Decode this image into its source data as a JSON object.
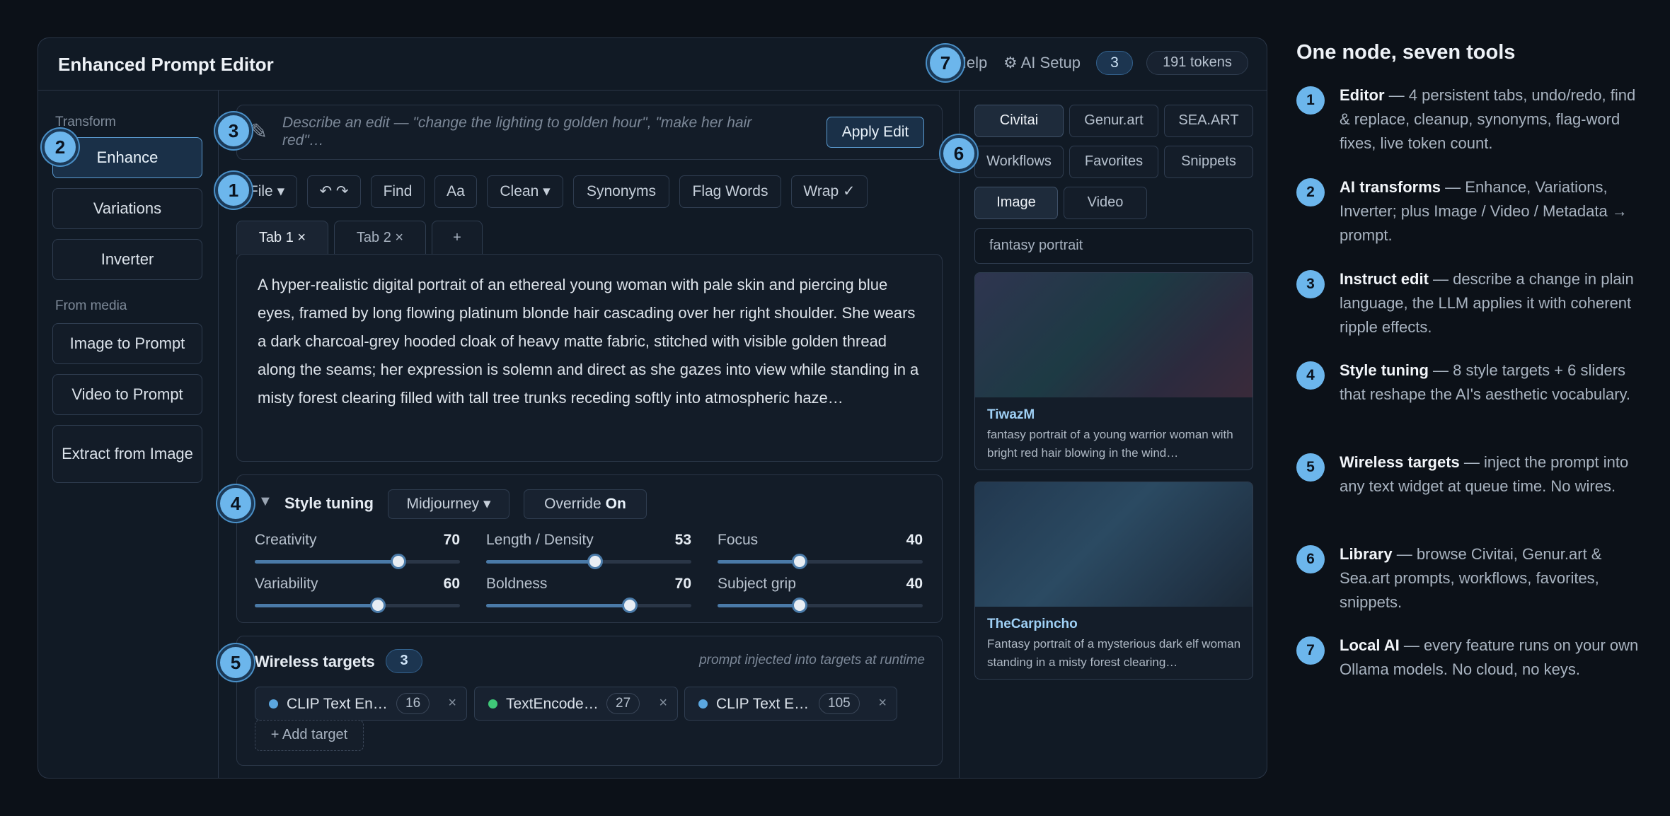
{
  "header": {
    "title": "Enhanced Prompt Editor",
    "help_label": "Help",
    "ai_setup_label": "⚙ AI Setup",
    "count": "3",
    "tokens": "191 tokens"
  },
  "sidebar": {
    "transform_label": "Transform",
    "transform_items": [
      "Enhance",
      "Variations",
      "Inverter"
    ],
    "media_label": "From media",
    "media_items": [
      "Image to Prompt",
      "Video to Prompt",
      "Extract from Image"
    ]
  },
  "instruct": {
    "placeholder": "Describe an edit — \"change the lighting to golden hour\", \"make her hair red\"…",
    "apply_label": "Apply Edit"
  },
  "toolbar": {
    "file": "File ▾",
    "undo_redo": "↶ ↷",
    "find": "Find",
    "aa": "Aa",
    "clean": "Clean ▾",
    "synonyms": "Synonyms",
    "flag_words": "Flag Words",
    "wrap": "Wrap ✓"
  },
  "tabs": [
    "Tab 1 ×",
    "Tab 2 ×",
    "+"
  ],
  "editor": {
    "text": "A hyper-realistic digital portrait of an ethereal young woman with pale skin and piercing blue eyes, framed by long flowing platinum blonde hair cascading over her right shoulder. She wears a dark charcoal-grey hooded cloak of heavy matte fabric, stitched with visible golden thread along the seams; her expression is solemn and direct as she gazes into view while standing in a misty forest clearing filled with tall tree trunks receding softly into atmospheric haze…"
  },
  "style_tuning": {
    "title": "Style tuning",
    "target": "Midjourney ▾",
    "override_label": "Override",
    "override_value": "On",
    "sliders": [
      {
        "label": "Creativity",
        "value": 70
      },
      {
        "label": "Length / Density",
        "value": 53
      },
      {
        "label": "Focus",
        "value": 40
      },
      {
        "label": "Variability",
        "value": 60
      },
      {
        "label": "Boldness",
        "value": 70
      },
      {
        "label": "Subject grip",
        "value": 40
      }
    ]
  },
  "wireless": {
    "title": "Wireless targets",
    "count": "3",
    "note": "prompt injected into targets at runtime",
    "targets": [
      {
        "name": "CLIP Text En…",
        "count": "16",
        "color": "#5ba7e0"
      },
      {
        "name": "TextEncode…",
        "count": "27",
        "color": "#3fc978"
      },
      {
        "name": "CLIP Text E…",
        "count": "105",
        "color": "#5ba7e0"
      }
    ],
    "add_label": "+ Add target"
  },
  "library": {
    "sources": [
      "Civitai",
      "Genur.art",
      "SEA.ART"
    ],
    "sections": [
      "Workflows",
      "Favorites",
      "Snippets"
    ],
    "media": [
      "Image",
      "Video"
    ],
    "search_value": "fantasy portrait",
    "cards": [
      {
        "author": "TiwazM",
        "desc": "fantasy portrait of a young warrior woman with bright red hair blowing in the wind…"
      },
      {
        "author": "TheCarpincho",
        "desc": "Fantasy portrait of a mysterious dark elf woman standing in a misty forest clearing…"
      }
    ]
  },
  "badges": [
    "1",
    "2",
    "3",
    "4",
    "5",
    "6",
    "7"
  ],
  "features": {
    "title": "One node, seven tools",
    "items": [
      {
        "num": "1",
        "name": "Editor",
        "desc": " — 4 persistent tabs, undo/redo, find & replace, cleanup, synonyms, flag-word fixes, live token count."
      },
      {
        "num": "2",
        "name": "AI transforms",
        "desc": " — Enhance, Variations, Inverter; plus Image / Video / Metadata → prompt."
      },
      {
        "num": "3",
        "name": "Instruct edit",
        "desc": " — describe a change in plain language, the LLM applies it with coherent ripple effects."
      },
      {
        "num": "4",
        "name": "Style tuning",
        "desc": " — 8 style targets + 6 sliders that reshape the AI's aesthetic vocabulary."
      },
      {
        "num": "5",
        "name": "Wireless targets",
        "desc": " — inject the prompt into any text widget at queue time. No wires."
      },
      {
        "num": "6",
        "name": "Library",
        "desc": " — browse Civitai, Genur.art & Sea.art prompts, workflows, favorites, snippets."
      },
      {
        "num": "7",
        "name": "Local AI",
        "desc": " — every feature runs on your own Ollama models. No cloud, no keys."
      }
    ]
  }
}
